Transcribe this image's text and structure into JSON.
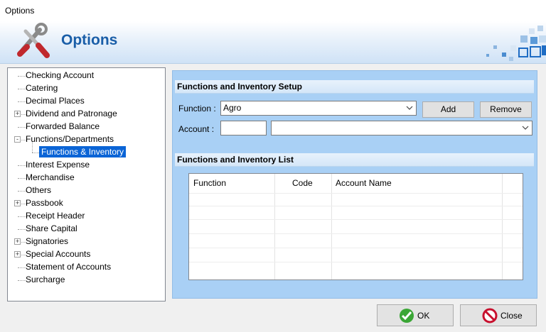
{
  "window": {
    "title": "Options"
  },
  "banner": {
    "title": "Options"
  },
  "tree": {
    "items": [
      {
        "label": "Checking Account",
        "expander": ""
      },
      {
        "label": "Catering",
        "expander": ""
      },
      {
        "label": "Decimal Places",
        "expander": ""
      },
      {
        "label": "Dividend and Patronage",
        "expander": "+"
      },
      {
        "label": "Forwarded Balance",
        "expander": ""
      },
      {
        "label": "Functions/Departments",
        "expander": "-"
      },
      {
        "label": "Functions & Inventory",
        "expander": "",
        "selected": true
      },
      {
        "label": "Interest Expense",
        "expander": ""
      },
      {
        "label": "Merchandise",
        "expander": ""
      },
      {
        "label": "Others",
        "expander": ""
      },
      {
        "label": "Passbook",
        "expander": "+"
      },
      {
        "label": "Receipt Header",
        "expander": ""
      },
      {
        "label": "Share Capital",
        "expander": ""
      },
      {
        "label": "Signatories",
        "expander": "+"
      },
      {
        "label": "Special Accounts",
        "expander": "+"
      },
      {
        "label": "Statement of Accounts",
        "expander": ""
      },
      {
        "label": "Surcharge",
        "expander": ""
      }
    ]
  },
  "setup": {
    "header": "Functions and Inventory Setup",
    "function_label": "Function :",
    "function_value": "Agro",
    "account_label": "Account :",
    "account_code": "",
    "account_name": "",
    "add_label": "Add",
    "remove_label": "Remove"
  },
  "list": {
    "header": "Functions and Inventory List",
    "columns": [
      "Function",
      "Code",
      "Account Name"
    ],
    "rows": []
  },
  "footer": {
    "ok_label": "OK",
    "close_label": "Close"
  },
  "colors": {
    "accent": "#0a64d6",
    "panel": "#a9d0f5",
    "title": "#1a5ea8"
  }
}
